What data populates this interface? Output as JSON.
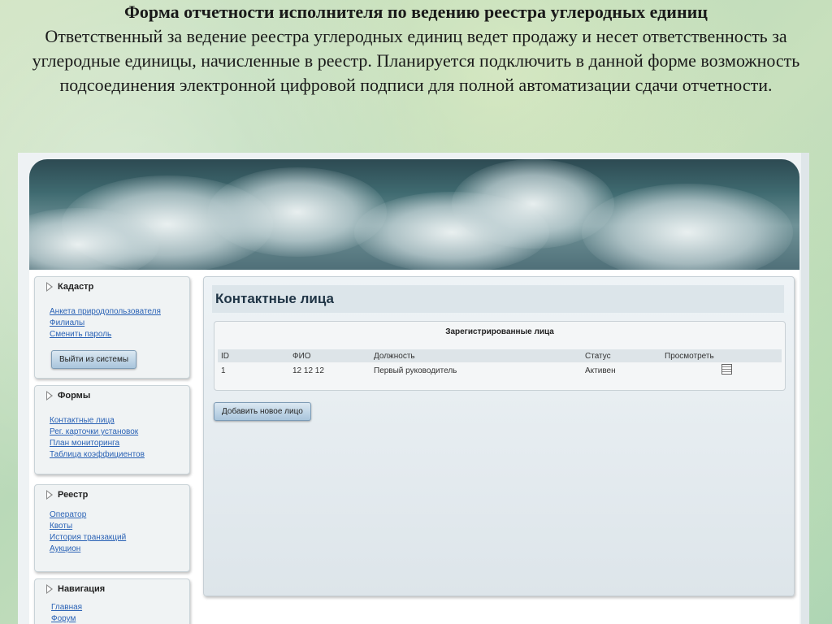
{
  "slide": {
    "title": "Форма отчетности исполнителя по ведению реестра углеродных единиц",
    "description": "Ответственный за ведение реестра углеродных единиц ведет продажу и несет ответственность за углеродные единицы, начисленные в реестр. Планируется подключить в данной форме возможность подсоединения электронной цифровой подписи для полной автоматизации сдачи отчетности."
  },
  "sidebar": {
    "cadastre": {
      "title": "Кадастр",
      "links": [
        "Анкета природопользователя",
        "Филиалы",
        "Сменить пароль"
      ],
      "logout_label": "Выйти из системы"
    },
    "forms": {
      "title": "Формы",
      "links": [
        "Контактные лица",
        "Рег. карточки установок",
        "План мониторинга",
        "Таблица коэффициентов"
      ]
    },
    "registry": {
      "title": "Реестр",
      "links": [
        "Оператор",
        "Квоты",
        "История транзакций",
        "Аукцион"
      ]
    },
    "navigation": {
      "title": "Навигация",
      "links": [
        "Главная",
        "Форум"
      ]
    }
  },
  "main": {
    "title": "Контактные лица",
    "table_caption": "Зарегистрированные лица",
    "columns": [
      "ID",
      "ФИО",
      "Должность",
      "Статус",
      "Просмотреть"
    ],
    "rows": [
      {
        "id": "1",
        "fio": "12 12 12",
        "position": "Первый руководитель",
        "status": "Активен",
        "view_icon": "document-view-icon"
      }
    ],
    "add_button": "Добавить новое лицо"
  }
}
